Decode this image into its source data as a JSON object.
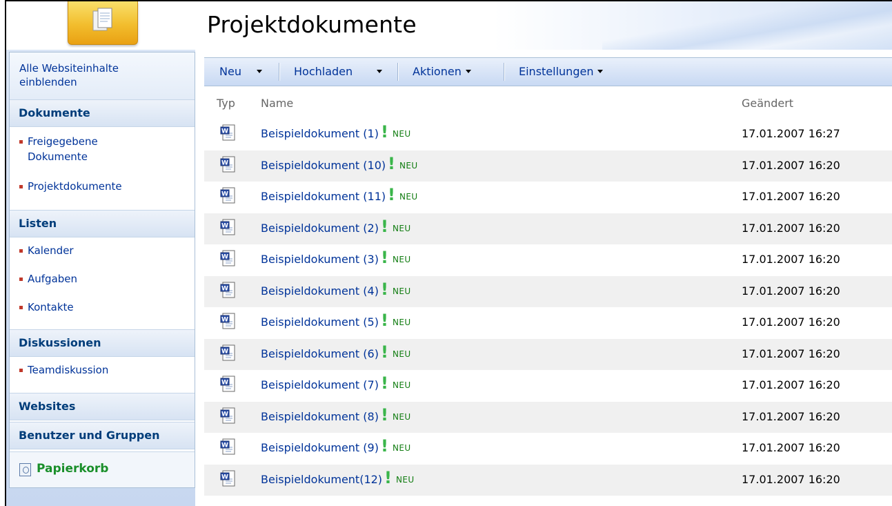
{
  "header": {
    "title": "Projektdokumente"
  },
  "leftnav": {
    "all_content": "Alle Websiteinhalte einblenden",
    "sections": [
      {
        "title": "Dokumente",
        "items": [
          "Freigegebene Dokumente",
          "Projektdokumente"
        ]
      },
      {
        "title": "Listen",
        "items": [
          "Kalender",
          "Aufgaben",
          "Kontakte"
        ]
      },
      {
        "title": "Diskussionen",
        "items": [
          "Teamdiskussion"
        ]
      },
      {
        "title": "Websites",
        "items": []
      },
      {
        "title": "Benutzer und Gruppen",
        "items": []
      }
    ],
    "recycle_bin": "Papierkorb"
  },
  "toolbar": {
    "new_label": "Neu",
    "upload_label": "Hochladen",
    "actions_label": "Aktionen",
    "settings_label": "Einstellungen"
  },
  "list": {
    "columns": {
      "type": "Typ",
      "name": "Name",
      "modified": "Geändert"
    },
    "new_marker": "NEU",
    "rows": [
      {
        "name": "Beispieldokument (1)",
        "modified": "17.01.2007 16:27"
      },
      {
        "name": "Beispieldokument (10)",
        "modified": "17.01.2007 16:20"
      },
      {
        "name": "Beispieldokument (11)",
        "modified": "17.01.2007 16:20"
      },
      {
        "name": "Beispieldokument (2)",
        "modified": "17.01.2007 16:20"
      },
      {
        "name": "Beispieldokument (3)",
        "modified": "17.01.2007 16:20"
      },
      {
        "name": "Beispieldokument (4)",
        "modified": "17.01.2007 16:20"
      },
      {
        "name": "Beispieldokument (5)",
        "modified": "17.01.2007 16:20"
      },
      {
        "name": "Beispieldokument (6)",
        "modified": "17.01.2007 16:20"
      },
      {
        "name": "Beispieldokument (7)",
        "modified": "17.01.2007 16:20"
      },
      {
        "name": "Beispieldokument (8)",
        "modified": "17.01.2007 16:20"
      },
      {
        "name": "Beispieldokument (9)",
        "modified": "17.01.2007 16:20"
      },
      {
        "name": "Beispieldokument(12)",
        "modified": "17.01.2007 16:20"
      }
    ]
  },
  "colors": {
    "link": "#003399",
    "new_badge": "#3ab54a",
    "recycle": "#1a8f2a",
    "toolbar_top": "#e9f0fb",
    "toolbar_bottom": "#c8d9f3"
  },
  "icons": {
    "logo": "document-library-icon",
    "file": "word-document-icon",
    "recycle": "recycle-bin-icon"
  }
}
